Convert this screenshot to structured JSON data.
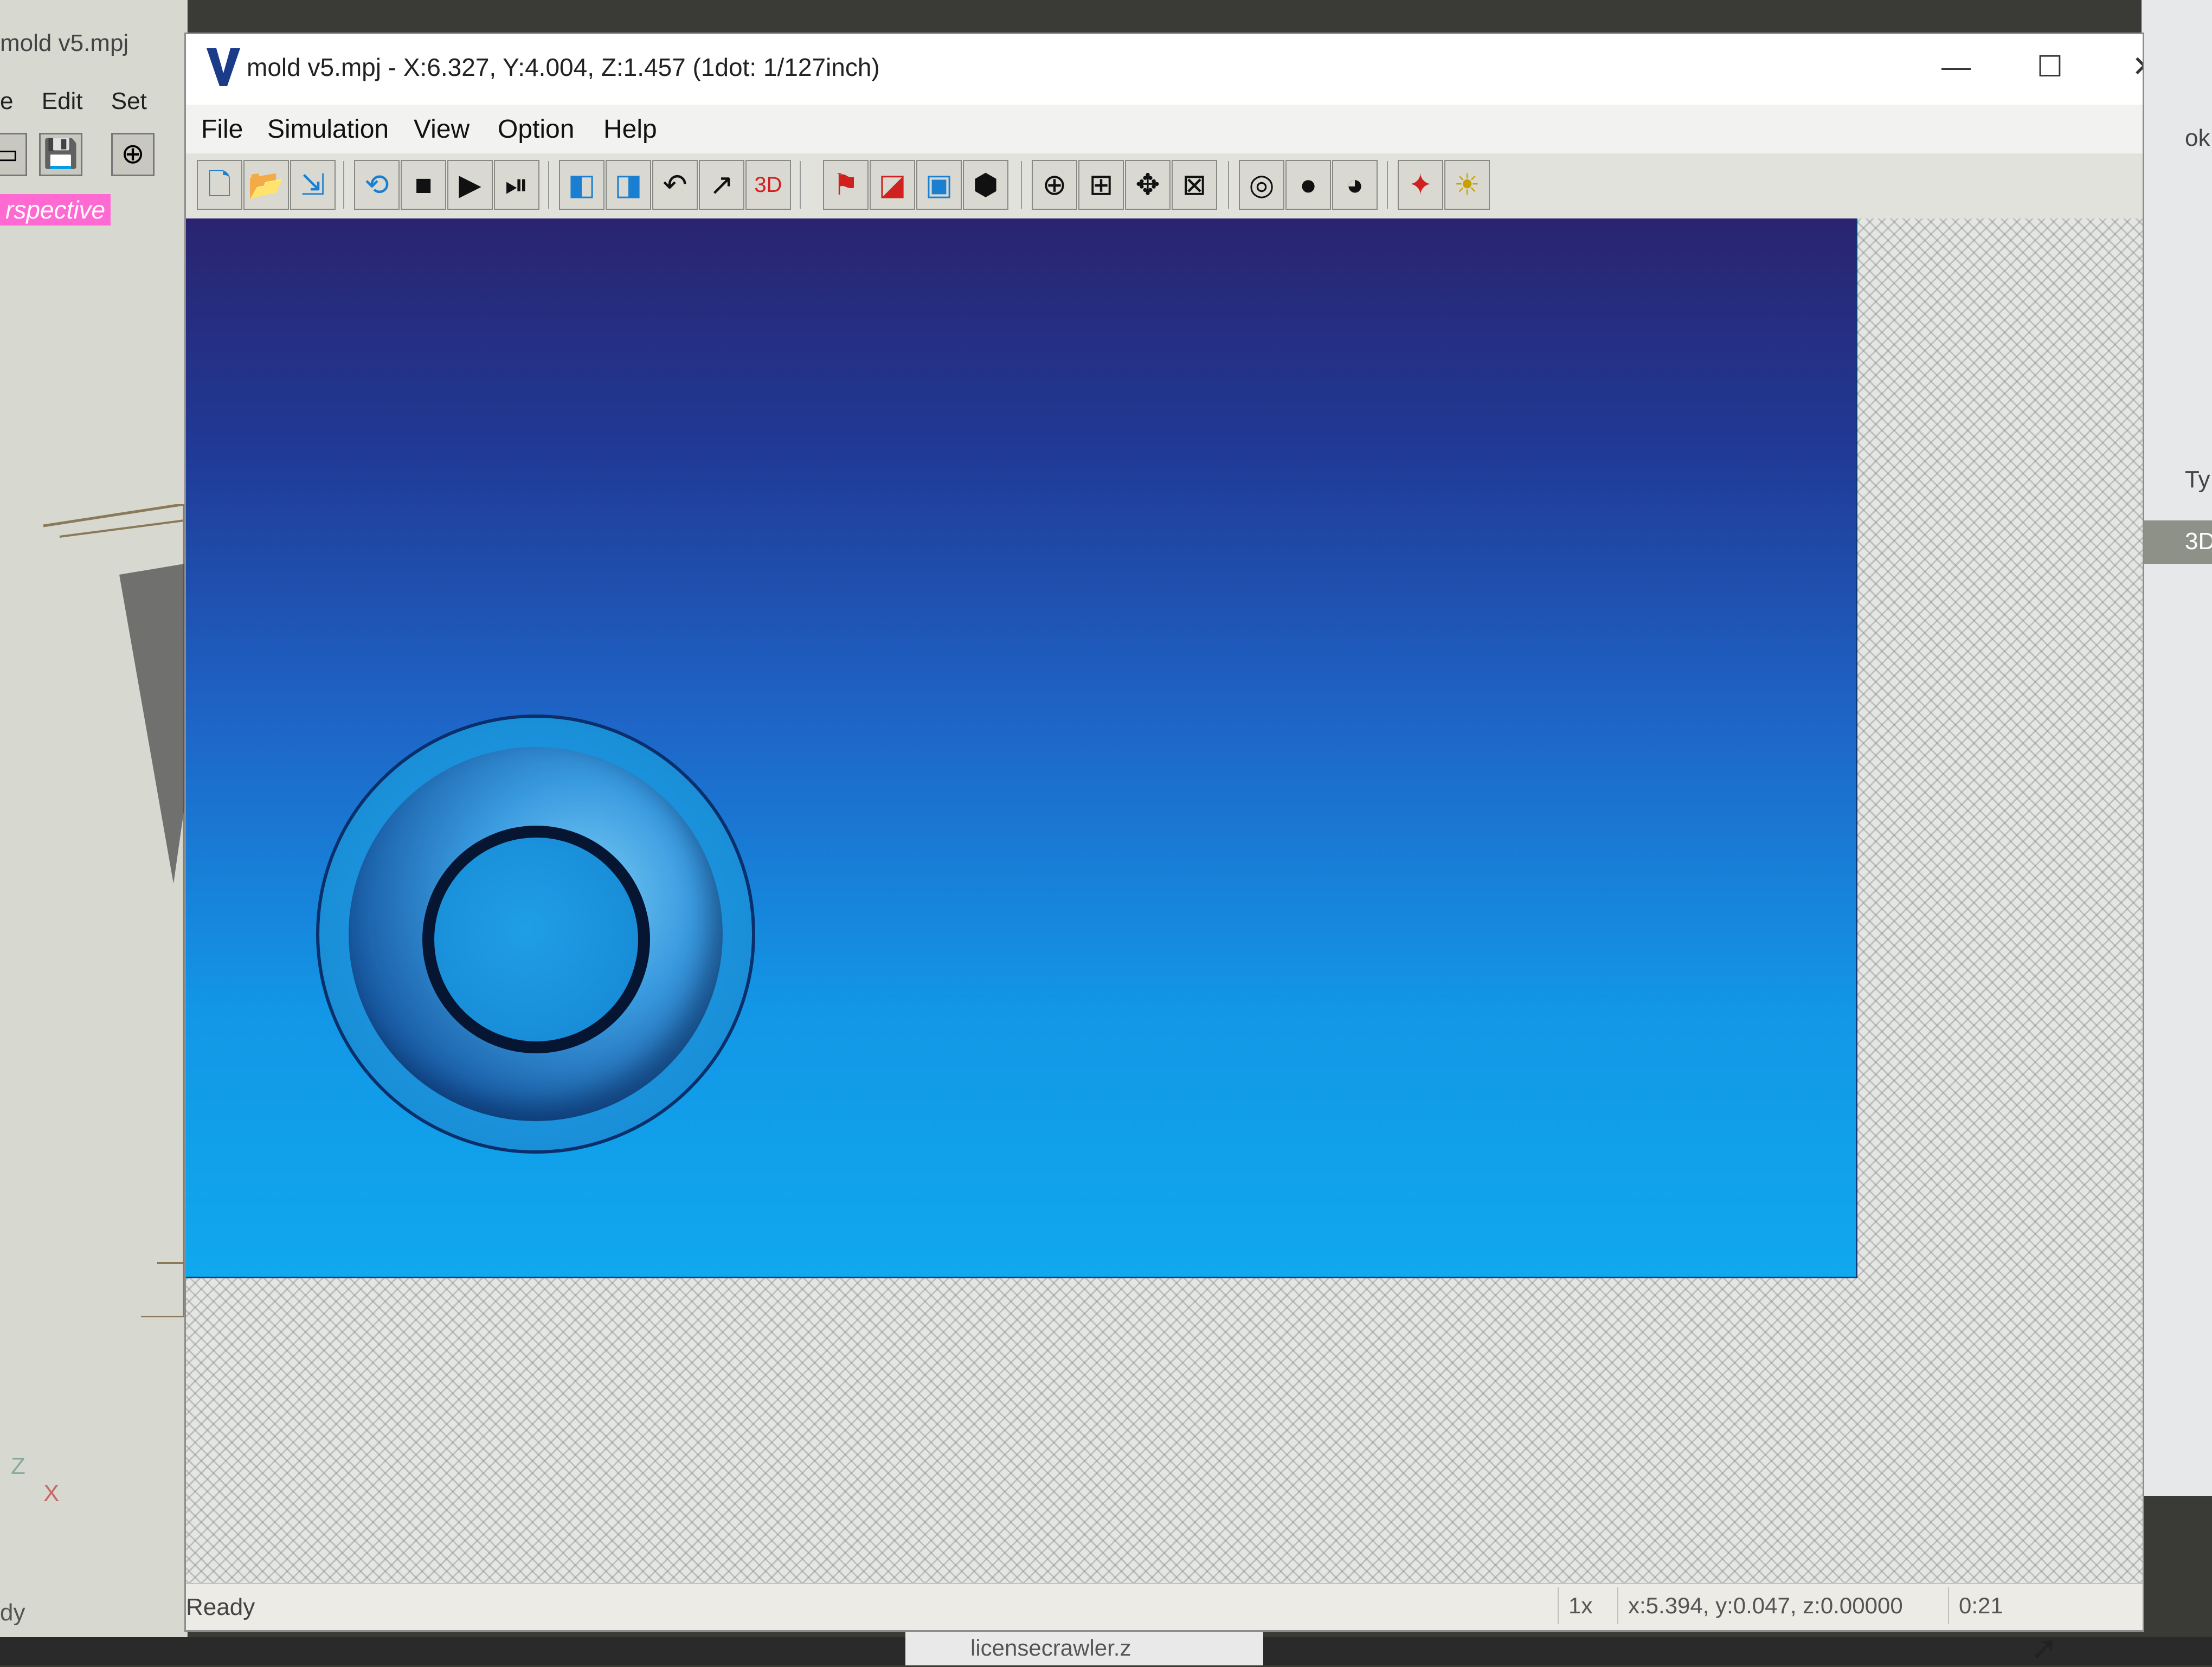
{
  "background_window": {
    "title": "mold v5.mpj",
    "menu": [
      "e",
      "Edit",
      "Set"
    ],
    "view_label": "rspective",
    "status": "dy",
    "axis_z": "Z",
    "axis_x": "X"
  },
  "right_panel": {
    "label_top": "ok",
    "label_type": "Ty",
    "label_3d": "3D"
  },
  "taskbar": {
    "file_label": "licensecrawler.z"
  },
  "window": {
    "title": "mold v5.mpj - X:6.327, Y:4.004, Z:1.457 (1dot: 1/127inch)",
    "app_icon": "v-logo-icon",
    "controls": {
      "minimize": "—",
      "maximize": "☐",
      "close": "✕"
    }
  },
  "menu": [
    "File",
    "Simulation",
    "View",
    "Option",
    "Help"
  ],
  "toolbar": [
    {
      "icon": "new-file-icon",
      "glyph": "🗋"
    },
    {
      "icon": "open-folder-icon",
      "glyph": "📂"
    },
    {
      "icon": "import-icon",
      "glyph": "⇲"
    },
    {
      "icon": "rewind-icon",
      "glyph": "⟲"
    },
    {
      "icon": "stop-icon",
      "glyph": "■"
    },
    {
      "icon": "play-icon",
      "glyph": "▶"
    },
    {
      "icon": "step-icon",
      "glyph": "⏯"
    },
    {
      "icon": "view-top-icon",
      "glyph": "◧"
    },
    {
      "icon": "view-side-icon",
      "glyph": "◨"
    },
    {
      "icon": "toolpath-in-icon",
      "glyph": "↶"
    },
    {
      "icon": "toolpath-out-icon",
      "glyph": "↗"
    },
    {
      "icon": "3d-view-icon",
      "glyph": "3D"
    },
    {
      "icon": "simulate-icon",
      "glyph": "⚑"
    },
    {
      "icon": "color-icon",
      "glyph": "◪"
    },
    {
      "icon": "frame-icon",
      "glyph": "▣"
    },
    {
      "icon": "solid-icon",
      "glyph": "⬢"
    },
    {
      "icon": "zoom-icon",
      "glyph": "⊕"
    },
    {
      "icon": "zoom-in-icon",
      "glyph": "⊞"
    },
    {
      "icon": "pan-icon",
      "glyph": "✥"
    },
    {
      "icon": "fit-icon",
      "glyph": "⊠"
    },
    {
      "icon": "wireframe-icon",
      "glyph": "◎"
    },
    {
      "icon": "shade-flat-icon",
      "glyph": "●"
    },
    {
      "icon": "shade-smooth-icon",
      "glyph": "◕"
    },
    {
      "icon": "material-icon",
      "glyph": "✦"
    },
    {
      "icon": "light-icon",
      "glyph": "☀"
    }
  ],
  "status": {
    "ready": "Ready",
    "zoom": "1x",
    "coords": "x:5.394, y:0.047, z:0.00000",
    "time": "0:21"
  },
  "colors": {
    "viewport_top": "#2a2470",
    "viewport_bottom": "#10a8ee",
    "part": "#1a8fd8",
    "highlight": "#ff6ad2"
  }
}
